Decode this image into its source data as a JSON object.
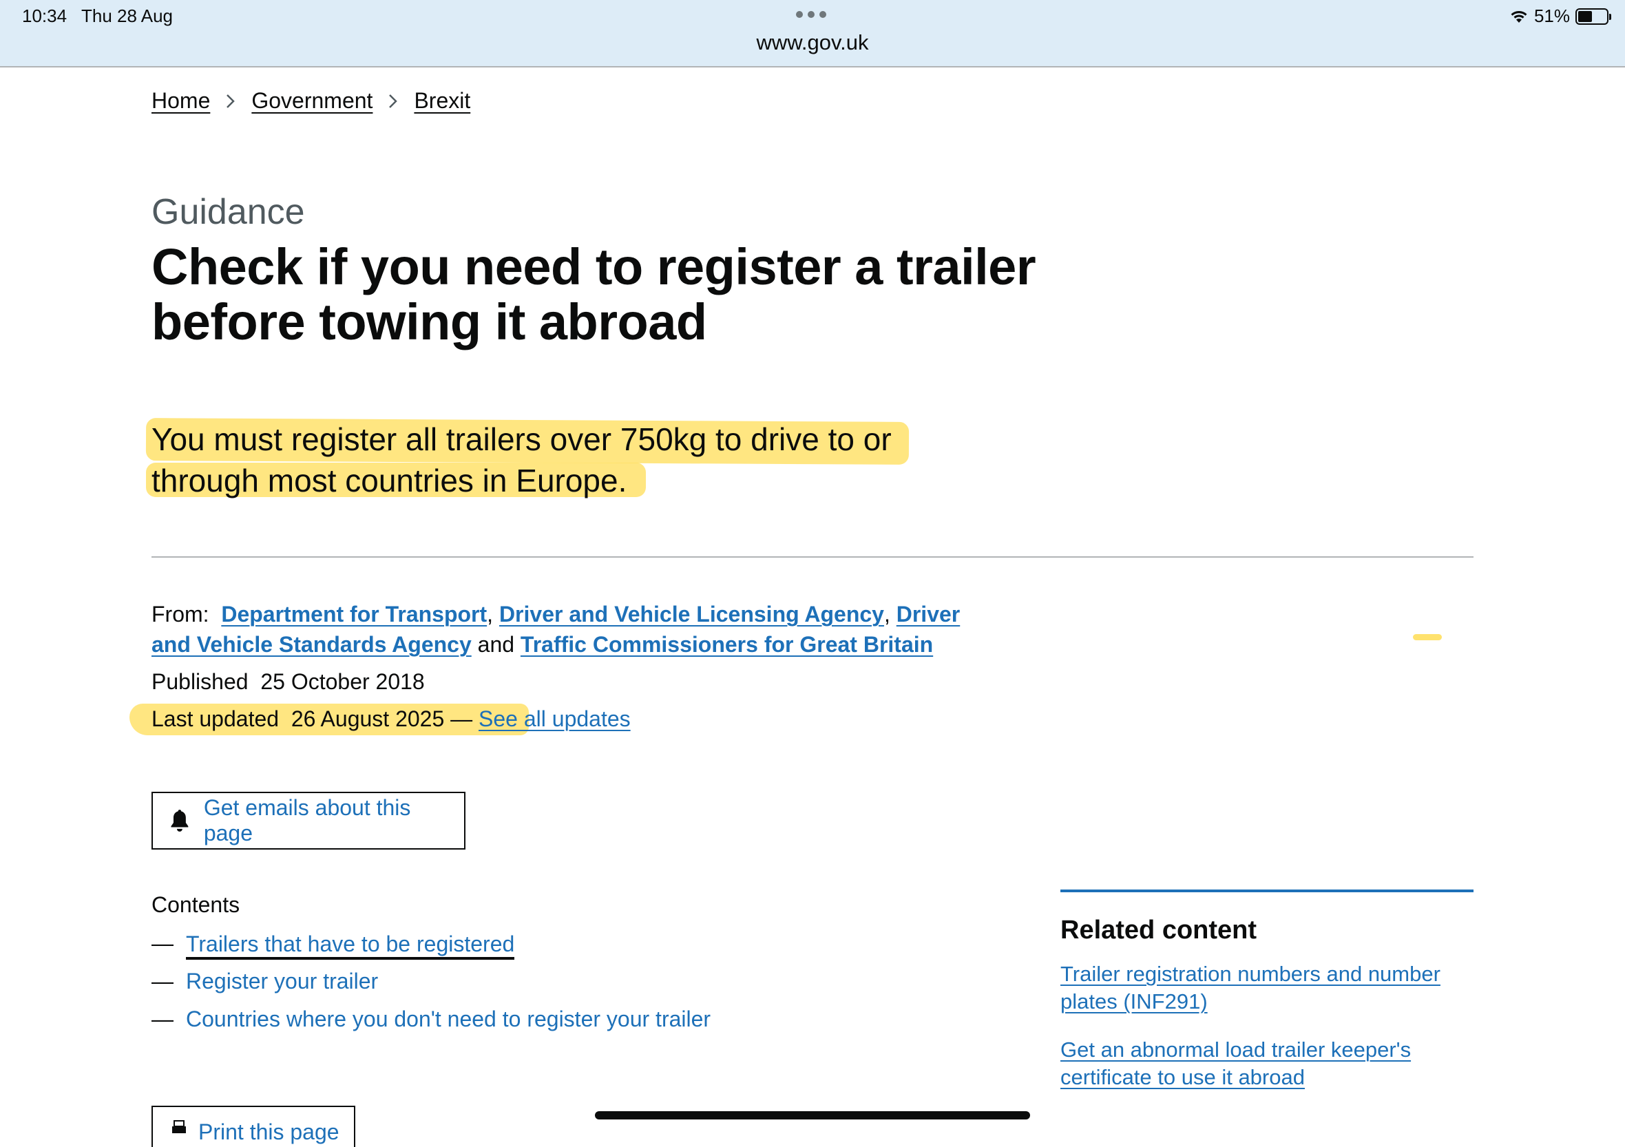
{
  "status_bar": {
    "time": "10:34",
    "date": "Thu 28 Aug",
    "url": "www.gov.uk",
    "battery": "51%"
  },
  "breadcrumbs": [
    "Home",
    "Government",
    "Brexit"
  ],
  "header": {
    "caption": "Guidance",
    "title": "Check if you need to register a trailer before towing it abroad"
  },
  "lead": {
    "line1": "You must register all trailers over 750kg to drive to or",
    "line2": "through most countries in Europe."
  },
  "metadata": {
    "from_label": "From:",
    "orgs": [
      "Department for Transport",
      "Driver and Vehicle Licensing Agency",
      "Driver and Vehicle Standards Agency",
      "Traffic Commissioners for Great Britain"
    ],
    "sep_comma": ",",
    "sep_and": "and",
    "published_label": "Published",
    "published_date": "25 October 2018",
    "updated_label": "Last updated",
    "updated_date": "26 August 2025",
    "updated_dash": "—",
    "see_all_updates": "See all updates"
  },
  "email_button": {
    "label": "Get emails about this page"
  },
  "contents": {
    "heading": "Contents",
    "dash": "—",
    "items": [
      "Trailers that have to be registered",
      "Register your trailer",
      "Countries where you don't need to register your trailer"
    ]
  },
  "print_button": {
    "label": "Print this page"
  },
  "related": {
    "heading": "Related content",
    "links": [
      "Trailer registration numbers and number plates (INF291)",
      "Get an abnormal load trailer keeper's certificate to use it abroad"
    ]
  },
  "colors": {
    "link": "#1d70b8",
    "text": "#0b0c0c",
    "highlight": "#ffdf5e",
    "status_bar_bg": "#ddecf7"
  }
}
